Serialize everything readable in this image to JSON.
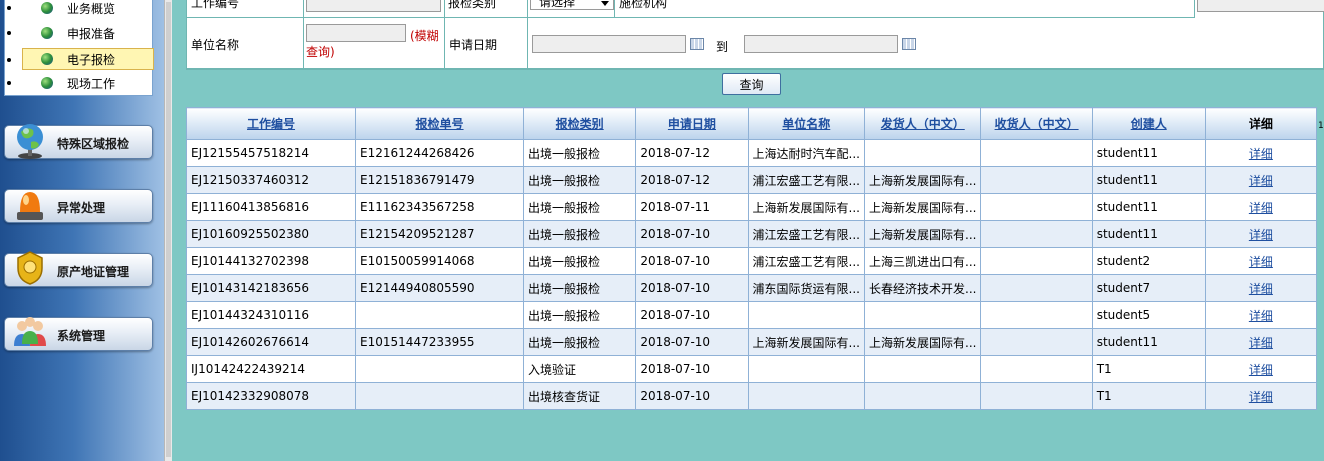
{
  "sidebar": {
    "submenu": [
      {
        "label": "业务概览"
      },
      {
        "label": "申报准备"
      },
      {
        "label": "电子报检",
        "active": true
      },
      {
        "label": "现场工作"
      }
    ],
    "sections": [
      {
        "label": "特殊区域报检",
        "icon": "globe-icon"
      },
      {
        "label": "异常处理",
        "icon": "alarm-light-icon"
      },
      {
        "label": "原产地证管理",
        "icon": "badge-icon"
      },
      {
        "label": "系统管理",
        "icon": "users-icon"
      }
    ]
  },
  "form": {
    "work_no_label": "工作编号",
    "insp_type_label": "报检类别",
    "insp_type_value": "请选择",
    "agency_label": "施检机构",
    "unit_name_label": "单位名称",
    "fuzzy_note": "(模糊查询)",
    "apply_date_label": "申请日期",
    "to_label": "到",
    "query_button": "查询"
  },
  "table": {
    "columns": [
      "工作编号",
      "报检单号",
      "报检类别",
      "申请日期",
      "单位名称",
      "发货人（中文）",
      "收货人（中文）",
      "创建人",
      "详细"
    ],
    "rows": [
      [
        "EJ12155457518214",
        "E12161244268426",
        "出境一般报检",
        "2018-07-12",
        "上海达耐时汽车配...",
        "",
        "",
        "student11",
        "详细"
      ],
      [
        "EJ12150337460312",
        "E12151836791479",
        "出境一般报检",
        "2018-07-12",
        "浦江宏盛工艺有限...",
        "上海新发展国际有...",
        "",
        "student11",
        "详细"
      ],
      [
        "EJ11160413856816",
        "E11162343567258",
        "出境一般报检",
        "2018-07-11",
        "上海新发展国际有...",
        "上海新发展国际有...",
        "",
        "student11",
        "详细"
      ],
      [
        "EJ10160925502380",
        "E12154209521287",
        "出境一般报检",
        "2018-07-10",
        "浦江宏盛工艺有限...",
        "上海新发展国际有...",
        "",
        "student11",
        "详细"
      ],
      [
        "EJ10144132702398",
        "E10150059914068",
        "出境一般报检",
        "2018-07-10",
        "浦江宏盛工艺有限...",
        "上海三凯进出口有...",
        "",
        "student2",
        "详细"
      ],
      [
        "EJ10143142183656",
        "E12144940805590",
        "出境一般报检",
        "2018-07-10",
        "浦东国际货运有限...",
        "长春经济技术开发...",
        "",
        "student7",
        "详细"
      ],
      [
        "EJ10144324310116",
        "",
        "出境一般报检",
        "2018-07-10",
        "",
        "",
        "",
        "student5",
        "详细"
      ],
      [
        "EJ10142602676614",
        "E10151447233955",
        "出境一般报检",
        "2018-07-10",
        "上海新发展国际有...",
        "上海新发展国际有...",
        "",
        "student11",
        "详细"
      ],
      [
        "IJ10142422439214",
        "",
        "入境验证",
        "2018-07-10",
        "",
        "",
        "",
        "T1",
        "详细"
      ],
      [
        "EJ10142332908078",
        "",
        "出境核查货证",
        "2018-07-10",
        "",
        "",
        "",
        "T1",
        "详细"
      ]
    ]
  },
  "edge_text": "1,"
}
